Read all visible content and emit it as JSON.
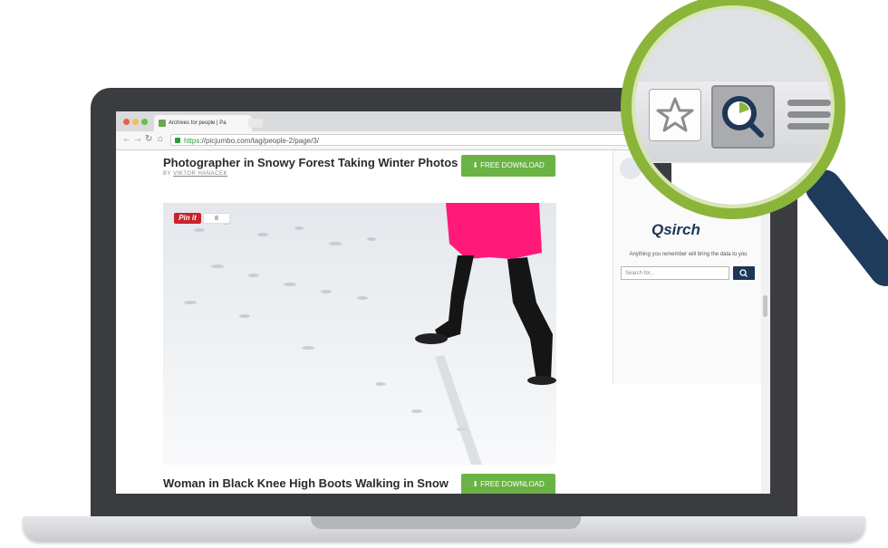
{
  "browser": {
    "tab_title": "Archives for people | Pa",
    "url_scheme": "https",
    "url_rest": "://picjumbo.com/tag/people-2/page/3/",
    "window_dots": [
      "#ee5a50",
      "#f5bd4f",
      "#5cc442"
    ]
  },
  "posts": [
    {
      "title": "Photographer in Snowy Forest Taking Winter Photos",
      "byline_prefix": "BY",
      "author": "VIKTOR HANACEK",
      "download_label": "FREE DOWNLOAD"
    },
    {
      "title": "Woman in Black Knee High Boots Walking in Snow",
      "download_label": "FREE DOWNLOAD"
    }
  ],
  "pinterest": {
    "label": "Pin it",
    "count": "8"
  },
  "extension": {
    "logo_text": "Qsirch",
    "tagline": "Anything you remember will bring the data to you",
    "search_placeholder": "Search for...",
    "search_icon": "search-icon"
  },
  "colors": {
    "accent_green": "#6bb344",
    "brand_navy": "#1e3756",
    "pinterest_red": "#c8232c",
    "magnifier_green": "#8bb53a"
  }
}
